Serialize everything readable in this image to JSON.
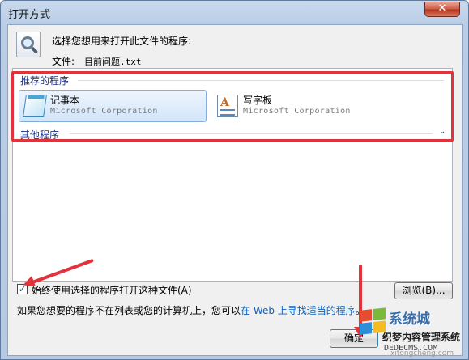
{
  "window": {
    "title": "打开方式",
    "close_glyph": "✕"
  },
  "header": {
    "prompt": "选择您想用来打开此文件的程序:",
    "file_label": "文件:",
    "file_name": "目前问题.txt"
  },
  "recommended": {
    "label": "推荐的程序",
    "programs": [
      {
        "name": "记事本",
        "company": "Microsoft Corporation",
        "icon": "notepad-icon",
        "selected": true
      },
      {
        "name": "写字板",
        "company": "Microsoft Corporation",
        "icon": "wordpad-icon",
        "selected": false
      }
    ]
  },
  "other": {
    "label": "其他程序",
    "expand_glyph": "⌄"
  },
  "bottom": {
    "always_use_label": "始终使用选择的程序打开这种文件(A)",
    "always_use_checked": true,
    "check_glyph": "✓",
    "browse_label": "浏览(B)...",
    "hint_before": "如果您想要的程序不在列表或您的计算机上，您可以",
    "hint_link": "在 Web 上寻找适当的程序",
    "hint_after": "。",
    "ok_label": "确定"
  },
  "watermark": {
    "brand": "系统城",
    "line2": "织梦内容管理系统",
    "line3": "DEDECMS.COM",
    "site": "xitongcheng.com"
  },
  "colors": {
    "annotation_red": "#e0333c",
    "link_blue": "#0b61c5",
    "group_label": "#1e3287"
  }
}
